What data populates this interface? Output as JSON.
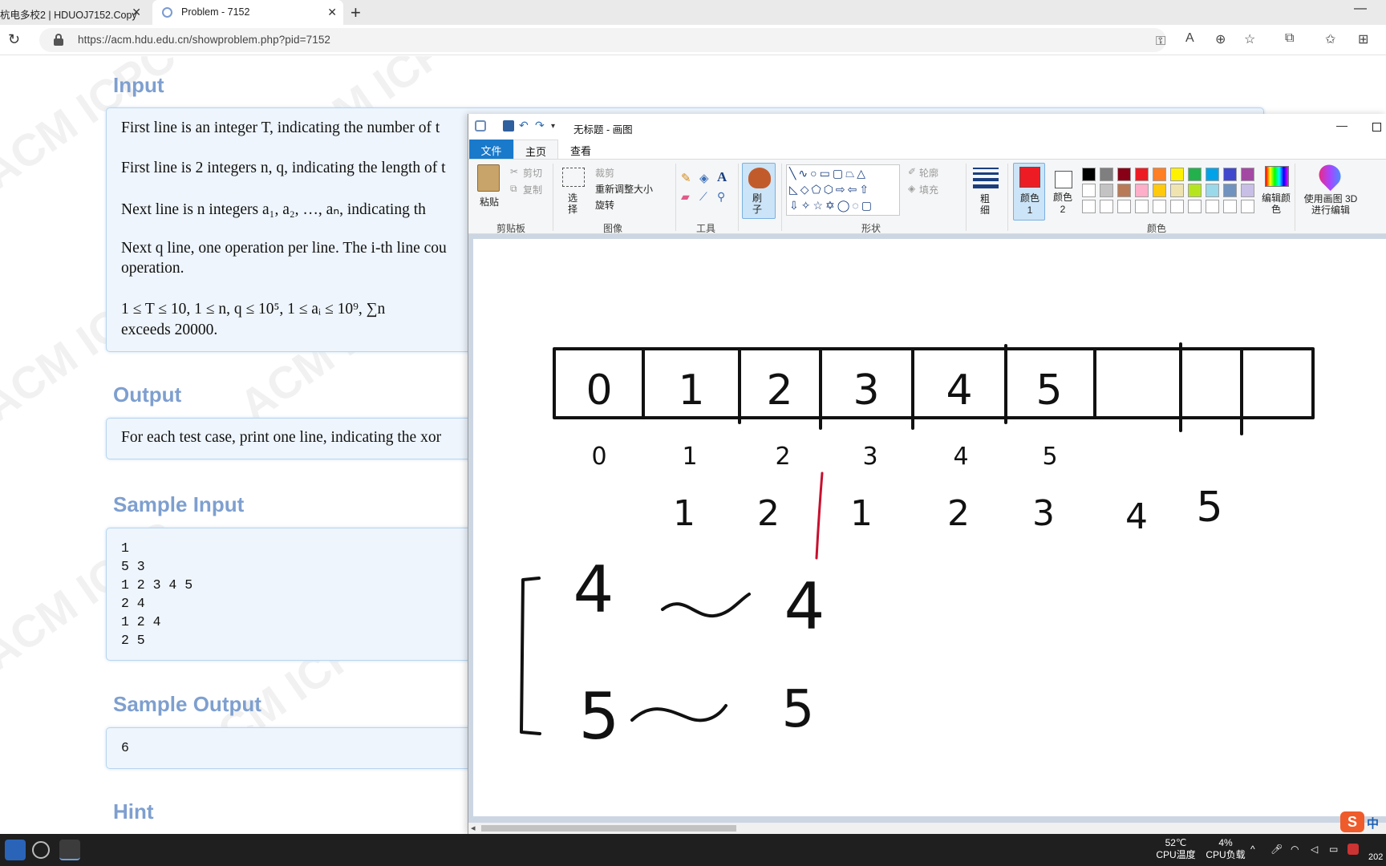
{
  "browser": {
    "tabs": [
      {
        "label": "杭电多校2 | HDUOJ7152.Copy",
        "active": false
      },
      {
        "label": "Problem - 7152",
        "active": true
      }
    ],
    "url": "https://acm.hdu.edu.cn/showproblem.php?pid=7152",
    "icons": [
      "reload-icon",
      "lock-icon",
      "key-icon",
      "read-aloud-icon",
      "zoom-icon",
      "favorite-add-icon",
      "extensions-icon",
      "favorites-icon",
      "collections-icon"
    ]
  },
  "page": {
    "watermark": "ACM ICPC",
    "sections": {
      "input_title": "Input",
      "input_lines": [
        "First line is an integer T, indicating the number of t",
        "First line is 2 integers n, q, indicating the length of t",
        "Next line is n integers a₁, a₂, …, aₙ, indicating th",
        "Next q line, one operation per line. The i-th line cou",
        "operation.",
        "1 ≤ T ≤ 10, 1 ≤ n, q ≤ 10⁵, 1 ≤ aᵢ ≤ 10⁹, ∑n",
        "exceeds 20000."
      ],
      "output_title": "Output",
      "output_line": "For each test case, print one line, indicating the xor",
      "sample_input_title": "Sample Input",
      "sample_input": "1\n5 3\n1 2 3 4 5\n2 4\n1 2 4\n2 5",
      "sample_output_title": "Sample Output",
      "sample_output": "6",
      "hint_title": "Hint"
    }
  },
  "paint": {
    "title": "无标题 - 画图",
    "ribbon_tabs": [
      "文件",
      "主页",
      "查看"
    ],
    "groups": {
      "clipboard": {
        "label": "剪贴板",
        "paste": "粘贴",
        "cut": "剪切",
        "copy": "复制"
      },
      "image": {
        "label": "图像",
        "select": "选择",
        "crop": "裁剪",
        "resize": "重新调整大小",
        "rotate": "旋转"
      },
      "tools": {
        "label": "工具"
      },
      "brush": {
        "label": "刷子"
      },
      "shapes": {
        "label": "形状",
        "outline": "轮廓",
        "fill": "填充"
      },
      "size": {
        "label": "粗细"
      },
      "colors": {
        "label": "颜色",
        "color1": "颜色 1",
        "color2": "颜色 2",
        "edit": "编辑颜色",
        "paint3d": "使用画图 3D 进行编辑"
      }
    },
    "palette": [
      "#000000",
      "#7f7f7f",
      "#880015",
      "#ed1c24",
      "#ff7f27",
      "#fff200",
      "#22b14c",
      "#00a2e8",
      "#3f48cc",
      "#a349a4",
      "#ffffff",
      "#c3c3c3",
      "#b97a57",
      "#ffaec9",
      "#ffc90e",
      "#efe4b0",
      "#b5e61d",
      "#99d9ea",
      "#7092be",
      "#c8bfe7"
    ],
    "drawing": {
      "cells": [
        "0",
        "1",
        "2",
        "3",
        "4",
        "5",
        "",
        "",
        ""
      ],
      "index_row": [
        "0",
        "1",
        "2",
        "3",
        "4",
        "5"
      ],
      "value_row": [
        "1",
        "2",
        "1",
        "2",
        "3",
        "4",
        "5"
      ],
      "ranges": [
        [
          "4",
          "4"
        ],
        [
          "5",
          "5"
        ]
      ]
    }
  },
  "taskbar": {
    "temp_value": "52℃",
    "temp_label": "CPU温度",
    "cpu_value": "4%",
    "cpu_label": "CPU负载",
    "ime": "中",
    "clock_partial": "202"
  }
}
